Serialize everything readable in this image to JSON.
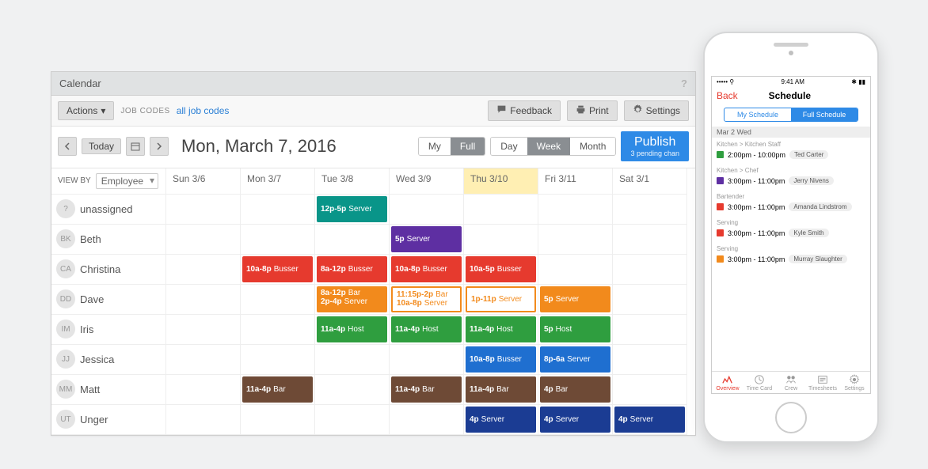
{
  "desktop": {
    "panel_title": "Calendar",
    "help": "?",
    "toolbar1": {
      "actions": "Actions",
      "job_codes_label": "JOB CODES",
      "all_job_codes": "all job codes",
      "feedback": "Feedback",
      "print": "Print",
      "settings": "Settings"
    },
    "toolbar2": {
      "today": "Today",
      "date_title": "Mon, March 7, 2016",
      "seg_view": {
        "my": "My",
        "full": "Full"
      },
      "seg_range": {
        "day": "Day",
        "week": "Week",
        "month": "Month"
      },
      "publish_main": "Publish",
      "publish_sub": "3 pending chan"
    },
    "columns": {
      "view_by": "VIEW BY",
      "selector": "Employee",
      "days": [
        "Sun 3/6",
        "Mon 3/7",
        "Tue 3/8",
        "Wed 3/9",
        "Thu 3/10",
        "Fri 3/11",
        "Sat 3/1"
      ],
      "highlight_index": 4
    },
    "employees": [
      {
        "initials": "?",
        "name": "unassigned"
      },
      {
        "initials": "BK",
        "name": "Beth"
      },
      {
        "initials": "CA",
        "name": "Christina"
      },
      {
        "initials": "DD",
        "name": "Dave"
      },
      {
        "initials": "IM",
        "name": "Iris"
      },
      {
        "initials": "JJ",
        "name": "Jessica"
      },
      {
        "initials": "MM",
        "name": "Matt"
      },
      {
        "initials": "UT",
        "name": "Unger"
      }
    ],
    "colors": {
      "teal": "#099589",
      "purple": "#5e2fa2",
      "red": "#e63a2e",
      "orange": "#f28a1c",
      "green": "#2f9e3f",
      "blue": "#1f6fd0",
      "brown": "#6e4a36",
      "indigo": "#1b3c93"
    },
    "shifts": [
      {
        "emp": 0,
        "day": 2,
        "color": "teal",
        "text": "12p-5p",
        "role": "Server"
      },
      {
        "emp": 1,
        "day": 3,
        "color": "purple",
        "text": "5p",
        "role": "Server"
      },
      {
        "emp": 2,
        "day": 1,
        "color": "red",
        "text": "10a-8p",
        "role": "Busser"
      },
      {
        "emp": 2,
        "day": 2,
        "color": "red",
        "text": "8a-12p",
        "role": "Busser"
      },
      {
        "emp": 2,
        "day": 3,
        "color": "red",
        "text": "10a-8p",
        "role": "Busser"
      },
      {
        "emp": 2,
        "day": 4,
        "color": "red",
        "text": "10a-5p",
        "role": "Busser"
      },
      {
        "emp": 3,
        "day": 2,
        "color": "orange",
        "lines": [
          {
            "t": "8a-12p",
            "r": "Bar"
          },
          {
            "t": "2p-4p",
            "r": "Server"
          }
        ]
      },
      {
        "emp": 3,
        "day": 3,
        "color": "orange",
        "outline": true,
        "lines": [
          {
            "t": "11:15p-2p",
            "r": "Bar"
          },
          {
            "t": "10a-8p",
            "r": "Server"
          }
        ]
      },
      {
        "emp": 3,
        "day": 4,
        "color": "orange",
        "outline": true,
        "text": "1p-11p",
        "role": "Server"
      },
      {
        "emp": 3,
        "day": 5,
        "color": "orange",
        "text": "5p",
        "role": "Server"
      },
      {
        "emp": 4,
        "day": 2,
        "color": "green",
        "text": "11a-4p",
        "role": "Host"
      },
      {
        "emp": 4,
        "day": 3,
        "color": "green",
        "text": "11a-4p",
        "role": "Host"
      },
      {
        "emp": 4,
        "day": 4,
        "color": "green",
        "text": "11a-4p",
        "role": "Host"
      },
      {
        "emp": 4,
        "day": 5,
        "color": "green",
        "text": "5p",
        "role": "Host"
      },
      {
        "emp": 5,
        "day": 4,
        "color": "blue",
        "text": "10a-8p",
        "role": "Busser"
      },
      {
        "emp": 5,
        "day": 5,
        "color": "blue",
        "text": "8p-6a",
        "role": "Server"
      },
      {
        "emp": 6,
        "day": 1,
        "color": "brown",
        "text": "11a-4p",
        "role": "Bar"
      },
      {
        "emp": 6,
        "day": 3,
        "color": "brown",
        "text": "11a-4p",
        "role": "Bar"
      },
      {
        "emp": 6,
        "day": 4,
        "color": "brown",
        "text": "11a-4p",
        "role": "Bar"
      },
      {
        "emp": 6,
        "day": 5,
        "color": "brown",
        "text": "4p",
        "role": "Bar"
      },
      {
        "emp": 7,
        "day": 4,
        "color": "indigo",
        "text": "4p",
        "role": "Server"
      },
      {
        "emp": 7,
        "day": 5,
        "color": "indigo",
        "text": "4p",
        "role": "Server"
      },
      {
        "emp": 7,
        "day": 6,
        "color": "indigo",
        "text": "4p",
        "role": "Server"
      }
    ]
  },
  "phone": {
    "statusbar": {
      "left": "•••••  ⚲",
      "center": "9:41 AM",
      "right": "✱ ▮▮"
    },
    "back": "Back",
    "title": "Schedule",
    "seg": {
      "my": "My Schedule",
      "full": "Full Schedule"
    },
    "day": "Mar 2 Wed",
    "entries": [
      {
        "section": "Kitchen > Kitchen Staff",
        "color": "#2f9e3f",
        "time": "2:00pm - 10:00pm",
        "person": "Ted Carter"
      },
      {
        "section": "Kitchen > Chef",
        "color": "#5e2fa2",
        "time": "3:00pm - 11:00pm",
        "person": "Jerry Nivens"
      },
      {
        "section": "Bartender",
        "color": "#e63a2e",
        "time": "3:00pm - 11:00pm",
        "person": "Amanda Lindstrom"
      },
      {
        "section": "Serving",
        "color": "#e63a2e",
        "time": "3:00pm - 11:00pm",
        "person": "Kyle Smith"
      },
      {
        "section": "Serving",
        "color": "#f28a1c",
        "time": "3:00pm - 11:00pm",
        "person": "Murray Slaughter"
      }
    ],
    "tabs": [
      "Overview",
      "Time Card",
      "Crew",
      "Timesheets",
      "Settings"
    ]
  }
}
